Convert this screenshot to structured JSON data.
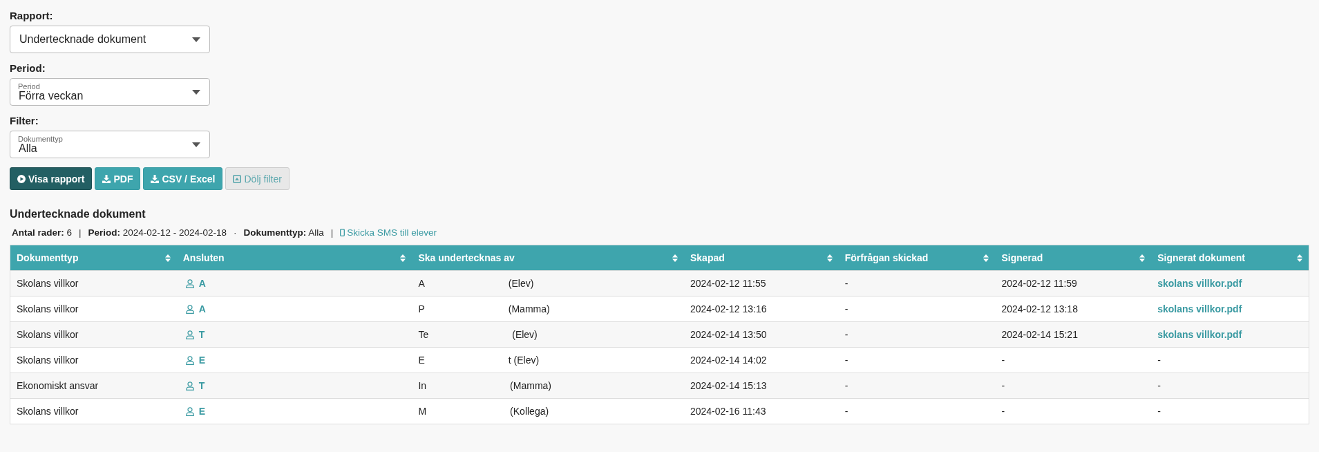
{
  "filters": [
    {
      "label": "Rapport:",
      "value": "Undertecknade dokument"
    },
    {
      "label": "Period:",
      "floating_label": "Period",
      "value": "Förra veckan"
    },
    {
      "label": "Filter:",
      "floating_label": "Dokumenttyp",
      "value": "Alla"
    }
  ],
  "buttons": [
    {
      "label": "Visa rapport",
      "kind": "primary"
    },
    {
      "label": "PDF",
      "kind": "teal"
    },
    {
      "label": "CSV / Excel",
      "kind": "teal"
    },
    {
      "label": "Dölj filter",
      "kind": "light"
    }
  ],
  "report": {
    "title": "Undertecknade dokument",
    "summary": [
      {
        "kind": "field",
        "label": "Antal rader:",
        "value": "6"
      },
      {
        "kind": "separator",
        "text": "|"
      },
      {
        "kind": "field",
        "label": "Period:",
        "value": "2024-02-12 - 2024-02-18"
      },
      {
        "kind": "separator",
        "text": "·"
      },
      {
        "kind": "field",
        "label": "Dokumenttyp:",
        "value": "Alla"
      },
      {
        "kind": "separator",
        "text": "|"
      },
      {
        "kind": "link",
        "text": "Skicka SMS till elever"
      }
    ]
  },
  "table": {
    "columns": [
      "Dokumenttyp",
      "Ansluten",
      "Ska undertecknas av",
      "Skapad",
      "Förfrågan skickad",
      "Signerad",
      "Signerat dokument"
    ],
    "rows": [
      {
        "document_type": "Skolans villkor",
        "connected": "A",
        "signer_start": "A",
        "signer_end": "(Elev)",
        "created": "2024-02-12 11:55",
        "request_sent": "-",
        "signed": "2024-02-12 11:59",
        "signed_document": "skolans villkor.pdf",
        "document_linked": true
      },
      {
        "document_type": "Skolans villkor",
        "connected": "A",
        "signer_start": "P",
        "signer_end": "(Mamma)",
        "created": "2024-02-12 13:16",
        "request_sent": "-",
        "signed": "2024-02-12 13:18",
        "signed_document": "skolans villkor.pdf",
        "document_linked": true
      },
      {
        "document_type": "Skolans villkor",
        "connected": "T",
        "signer_start": "Te",
        "signer_end": "(Elev)",
        "created": "2024-02-14 13:50",
        "request_sent": "-",
        "signed": "2024-02-14 15:21",
        "signed_document": "skolans villkor.pdf",
        "document_linked": true
      },
      {
        "document_type": "Skolans villkor",
        "connected": "E",
        "signer_start": "E",
        "signer_end": "t (Elev)",
        "created": "2024-02-14 14:02",
        "request_sent": "-",
        "signed": "-",
        "signed_document": "-",
        "document_linked": false
      },
      {
        "document_type": "Ekonomiskt ansvar",
        "connected": "T",
        "signer_start": "In",
        "signer_end": "(Mamma)",
        "created": "2024-02-14 15:13",
        "request_sent": "-",
        "signed": "-",
        "signed_document": "-",
        "document_linked": false
      },
      {
        "document_type": "Skolans villkor",
        "connected": "E",
        "signer_start": "M",
        "signer_end": "(Kollega)",
        "created": "2024-02-16 11:43",
        "request_sent": "-",
        "signed": "-",
        "signed_document": "-",
        "document_linked": false
      }
    ]
  }
}
